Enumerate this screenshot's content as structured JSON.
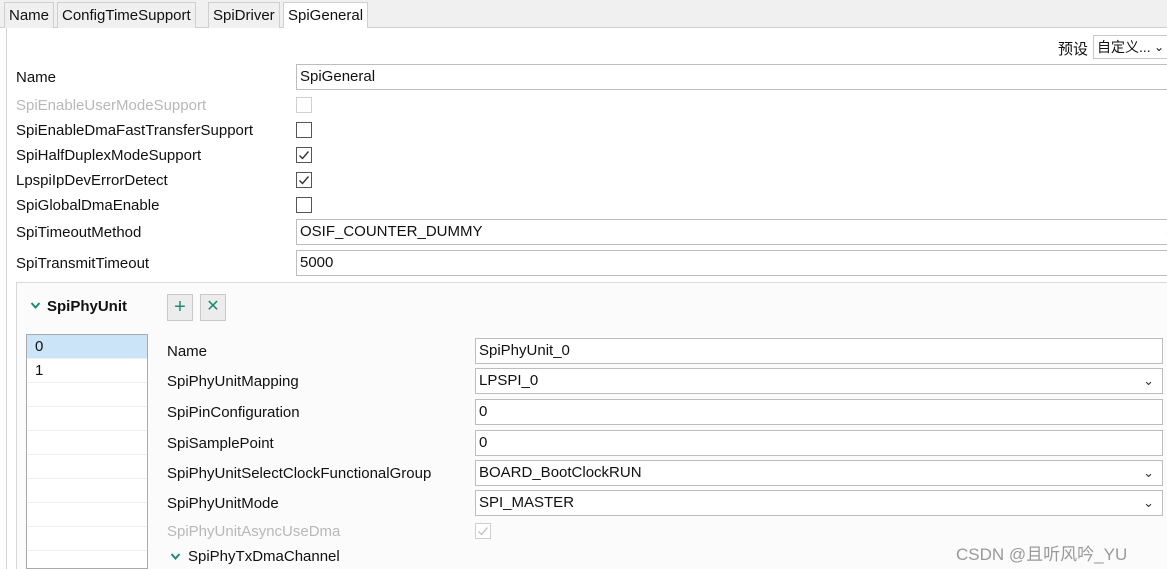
{
  "tabs": [
    "Name",
    "ConfigTimeSupport",
    "SpiDriver",
    "SpiGeneral"
  ],
  "active_tab": "SpiGeneral",
  "preset": {
    "label": "预设",
    "value": "自定义..."
  },
  "fields": {
    "name": {
      "label": "Name",
      "value": "SpiGeneral"
    },
    "user_mode": {
      "label": "SpiEnableUserModeSupport",
      "checked": false,
      "disabled": true
    },
    "dma_fast": {
      "label": "SpiEnableDmaFastTransferSupport",
      "checked": false
    },
    "half_duplex": {
      "label": "SpiHalfDuplexModeSupport",
      "checked": true
    },
    "dev_error": {
      "label": "LpspiIpDevErrorDetect",
      "checked": true
    },
    "global_dma": {
      "label": "SpiGlobalDmaEnable",
      "checked": false
    },
    "timeout_method": {
      "label": "SpiTimeoutMethod",
      "value": "OSIF_COUNTER_DUMMY"
    },
    "transmit_timeout": {
      "label": "SpiTransmitTimeout",
      "value": "5000"
    }
  },
  "phy_section": {
    "title": "SpiPhyUnit",
    "add_symbol": "+",
    "remove_symbol": "✕",
    "list": [
      "0",
      "1"
    ],
    "selected": "0",
    "props": {
      "name": {
        "label": "Name",
        "value": "SpiPhyUnit_0"
      },
      "mapping": {
        "label": "SpiPhyUnitMapping",
        "value": "LPSPI_0"
      },
      "pin_config": {
        "label": "SpiPinConfiguration",
        "value": "0"
      },
      "sample_point": {
        "label": "SpiSamplePoint",
        "value": "0"
      },
      "clock_group": {
        "label": "SpiPhyUnitSelectClockFunctionalGroup",
        "value": "BOARD_BootClockRUN"
      },
      "mode": {
        "label": "SpiPhyUnitMode",
        "value": "SPI_MASTER"
      },
      "async_dma": {
        "label": "SpiPhyUnitAsyncUseDma",
        "checked": true,
        "disabled": true
      },
      "tx_dma": {
        "label": "SpiPhyTxDmaChannel"
      }
    }
  },
  "watermark": "CSDN @且听风吟_YU",
  "colors": {
    "accent": "#1f8a6e",
    "selection": "#cce4f7",
    "disabled_text": "#b8b8b8"
  },
  "icons": {
    "dropdown": "chevron-down-icon",
    "section": "chevron-down-icon",
    "check": "checkmark-icon"
  }
}
